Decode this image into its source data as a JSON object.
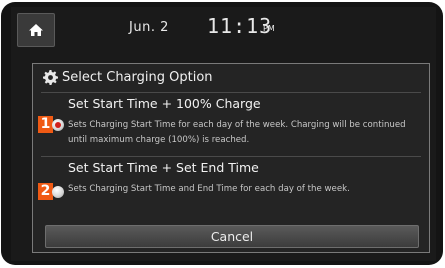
{
  "status": {
    "date": "Jun. 2",
    "time": "11:13",
    "ampm": "PM"
  },
  "dialog": {
    "title": "Select Charging Option",
    "options": [
      {
        "callout": "1",
        "title": "Set Start Time + 100% Charge",
        "description": "Sets Charging Start Time for each day of the week. Charging will be continued until maximum charge (100%) is reached.",
        "selected": true
      },
      {
        "callout": "2",
        "title": "Set Start Time + Set End Time",
        "description": "Sets Charging Start Time and End Time for each day of the week.",
        "selected": false
      }
    ],
    "cancel_label": "Cancel"
  },
  "icons": {
    "home": "home-icon",
    "settings": "gear-icon"
  },
  "colors": {
    "callout": "#f05a14",
    "radio_selected": "#d0201c",
    "background": "#1a1a1a"
  }
}
